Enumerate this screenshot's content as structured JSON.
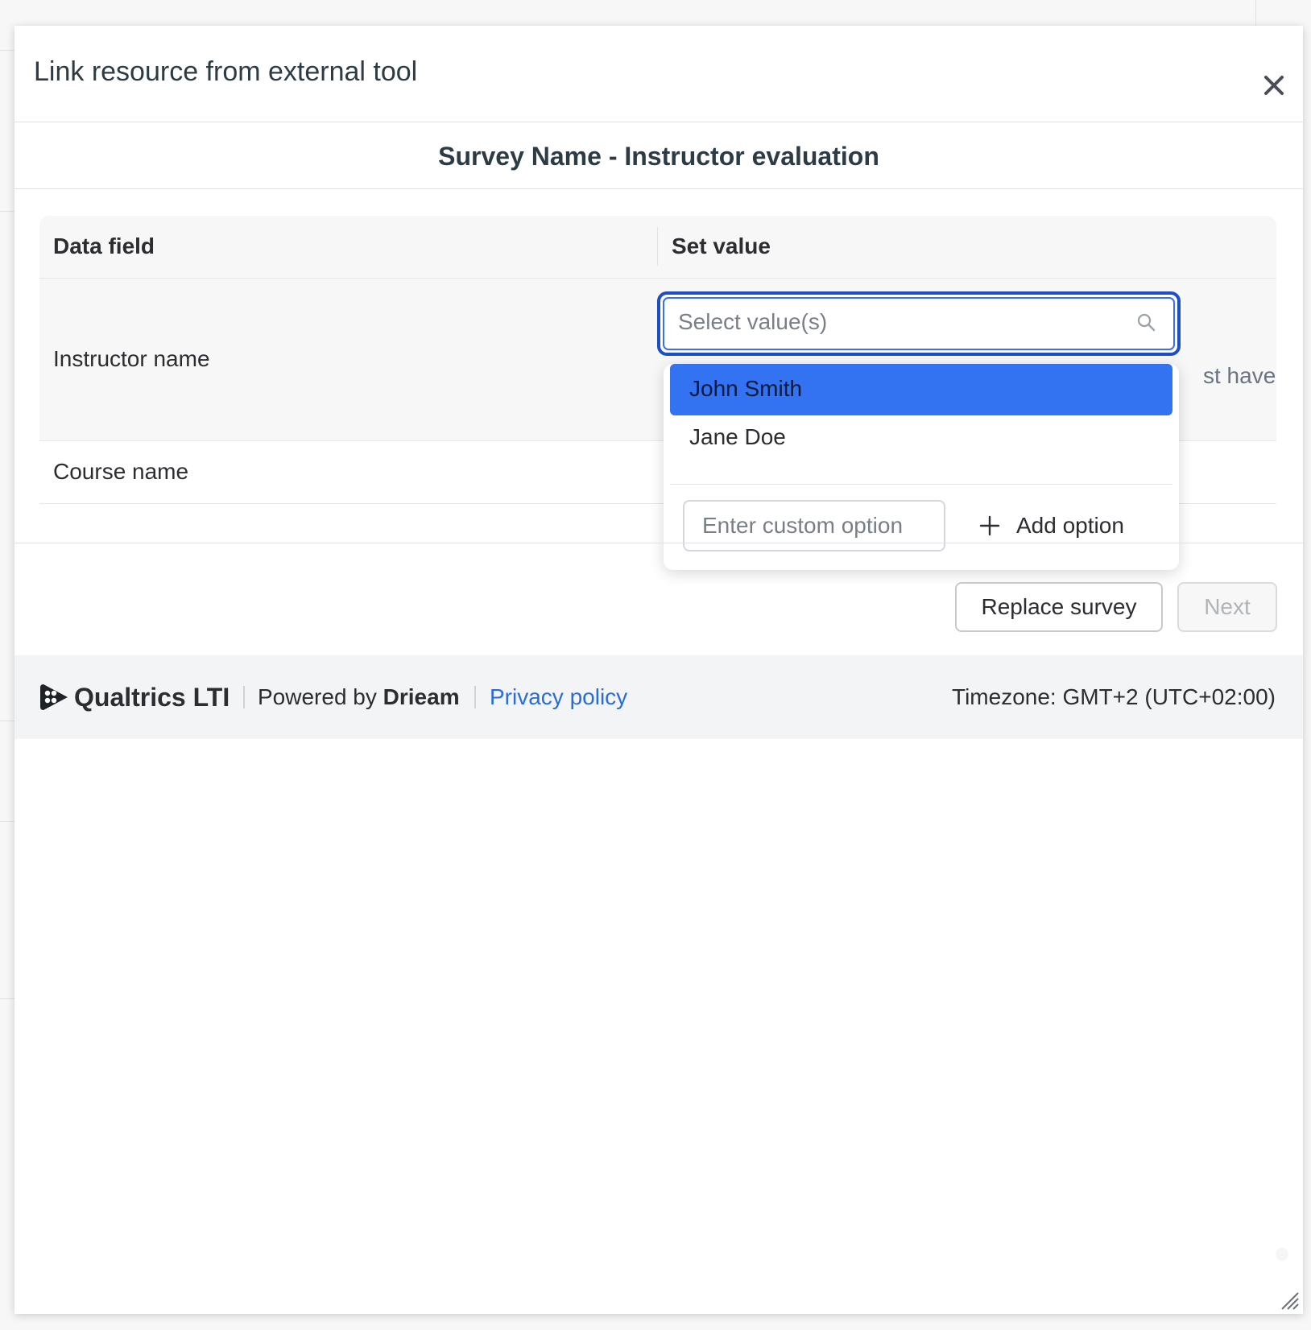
{
  "dialog": {
    "title": "Link resource from external tool",
    "close_icon": "close-icon"
  },
  "survey": {
    "title": "Survey Name - Instructor evaluation"
  },
  "table": {
    "headers": {
      "field": "Data field",
      "value": "Set value"
    },
    "rows": [
      {
        "label": "Instructor name",
        "hint_fragment": "st have"
      },
      {
        "label": "Course name"
      }
    ]
  },
  "select": {
    "placeholder": "Select value(s)",
    "icon": "search-icon",
    "options": [
      {
        "label": "John Smith",
        "selected": true
      },
      {
        "label": "Jane Doe",
        "selected": false
      }
    ],
    "custom_placeholder": "Enter custom option",
    "add_label": "Add option",
    "add_icon": "plus-icon"
  },
  "actions": {
    "replace": "Replace survey",
    "next": "Next"
  },
  "footer": {
    "brand": "Qualtrics LTI",
    "powered_prefix": "Powered by",
    "powered_name": "Drieam",
    "privacy": "Privacy policy",
    "timezone": "Timezone: GMT+2 (UTC+02:00)"
  },
  "colors": {
    "accent": "#3372f0",
    "focus_ring": "#1d4ec7",
    "link": "#2a6dd6",
    "footer_bg": "#f3f4f6"
  }
}
